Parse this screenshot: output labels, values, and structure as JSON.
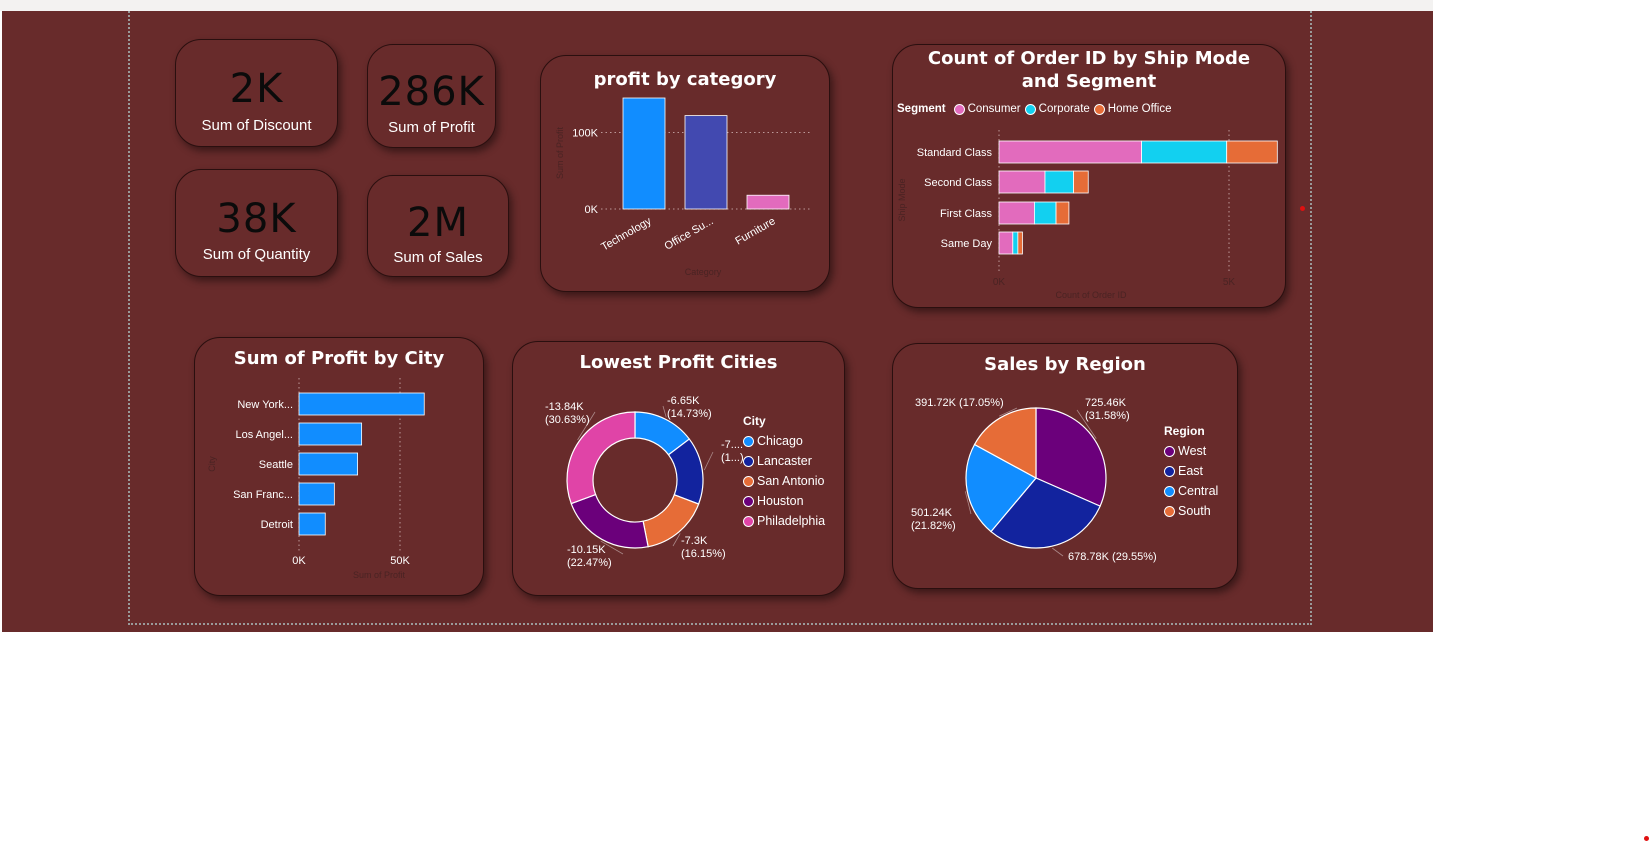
{
  "kpis": {
    "discount": {
      "value": "2K",
      "label": "Sum of Discount"
    },
    "profit": {
      "value": "286K",
      "label": "Sum of Profit"
    },
    "quantity": {
      "value": "38K",
      "label": "Sum of Quantity"
    },
    "sales": {
      "value": "2M",
      "label": "Sum of Sales"
    }
  },
  "colors": {
    "canvas": "#682b2b",
    "blue": "#118dff",
    "navy": "#12239e",
    "orange": "#e66c37",
    "purple": "#6b007b",
    "pink": "#e044a7",
    "cyan": "#12d0f0",
    "indigo": "#4249b0",
    "consumer_pink": "#e26bbd"
  },
  "chart_data": [
    {
      "id": "profit_by_category",
      "type": "bar",
      "title": "profit by category",
      "xlabel": "Category",
      "ylabel": "Sum of Profit",
      "categories": [
        "Technology",
        "Office Su...",
        "Furniture"
      ],
      "values": [
        145000,
        122000,
        18000
      ],
      "yticks": [
        "100K",
        "0K"
      ],
      "ylim": [
        0,
        145000
      ]
    },
    {
      "id": "orders_by_shipmode_segment",
      "type": "bar",
      "orientation": "horizontal-stacked",
      "title": "Count of Order ID by Ship Mode and Segment",
      "legend_title": "Segment",
      "xlabel": "Count of Order ID",
      "ylabel": "Ship Mode",
      "categories": [
        "Standard Class",
        "Second Class",
        "First Class",
        "Same Day"
      ],
      "series": [
        {
          "name": "Consumer",
          "values": [
            3100,
            1000,
            770,
            300
          ]
        },
        {
          "name": "Corporate",
          "values": [
            1850,
            620,
            470,
            110
          ]
        },
        {
          "name": "Home Office",
          "values": [
            1100,
            320,
            280,
            100
          ]
        }
      ],
      "xticks": [
        "0K",
        "5K"
      ],
      "xlim": [
        0,
        6050
      ]
    },
    {
      "id": "profit_by_city",
      "type": "bar",
      "orientation": "horizontal",
      "title": "Sum of Profit by City",
      "xlabel": "Sum of Profit",
      "ylabel": "City",
      "categories": [
        "New York...",
        "Los Angel...",
        "Seattle",
        "San Franc...",
        "Detroit"
      ],
      "values": [
        62000,
        31000,
        29000,
        17500,
        13000
      ],
      "xticks": [
        "0K",
        "50K"
      ],
      "xlim": [
        0,
        75000
      ]
    },
    {
      "id": "lowest_profit_cities",
      "type": "pie",
      "style": "donut",
      "title": "Lowest Profit Cities",
      "legend_title": "City",
      "series": [
        {
          "name": "Chicago",
          "value": -6.65,
          "label": [
            "-6.65K",
            "(14.73%)"
          ]
        },
        {
          "name": "Lancaster",
          "value": -7.24,
          "label": [
            "-7....",
            "(1...)"
          ]
        },
        {
          "name": "San Antonio",
          "value": -7.3,
          "label": [
            "-7.3K",
            "(16.15%)"
          ]
        },
        {
          "name": "Houston",
          "value": -10.15,
          "label": [
            "-10.15K",
            "(22.47%)"
          ]
        },
        {
          "name": "Philadelphia",
          "value": -13.84,
          "label": [
            "-13.84K",
            "(30.63%)"
          ]
        }
      ]
    },
    {
      "id": "sales_by_region",
      "type": "pie",
      "title": "Sales by Region",
      "legend_title": "Region",
      "series": [
        {
          "name": "West",
          "value": 725.46,
          "label": [
            "725.46K",
            "(31.58%)"
          ]
        },
        {
          "name": "East",
          "value": 678.78,
          "label": [
            "678.78K (29.55%)"
          ]
        },
        {
          "name": "Central",
          "value": 501.24,
          "label": [
            "501.24K",
            "(21.82%)"
          ]
        },
        {
          "name": "South",
          "value": 391.72,
          "label": [
            "391.72K (17.05%)"
          ]
        }
      ]
    }
  ]
}
